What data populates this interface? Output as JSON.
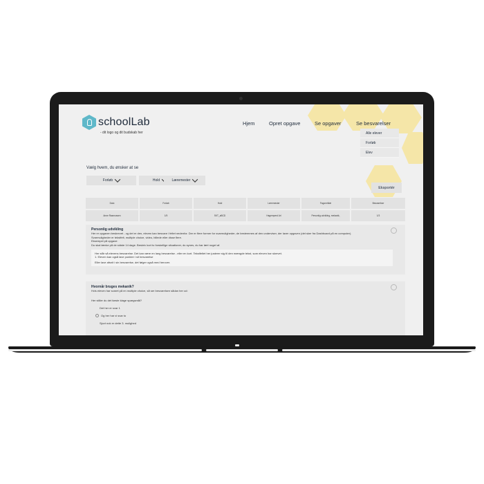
{
  "colors": {
    "accent": "#5fb8c9",
    "hex_yellow": "#f5e6a8",
    "panel": "#e2e2e2"
  },
  "logo": {
    "name": "schoolLab",
    "tagline": "- dit logo og dit budskab her",
    "icon": "lightbulb-icon"
  },
  "nav": {
    "home": "Hjem",
    "create": "Opret opgave",
    "tasks": "Se opgaver",
    "answers": "Se besvarelser",
    "dropdown": [
      "Alle elever",
      "Forløb",
      "Elev"
    ]
  },
  "filters": {
    "heading": "Vælg hvem, du ønsker at se",
    "items": [
      "Forløb",
      "Hold",
      "Læremester"
    ],
    "export": "Eksportér"
  },
  "table": {
    "headers": [
      "Dato",
      "Forløb",
      "Hold",
      "Læremester",
      "Fagområde",
      "Besvarelser"
    ],
    "row": [
      "Anne Rasmussen",
      "1/5",
      "SKT_aBCD",
      "Hagemperd Arl",
      "Personlig udvikling, mekanik,",
      "1/3"
    ]
  },
  "card1": {
    "title": "Personlig udvikling",
    "lines": [
      "Her er opgaven beskrevet - og det er den, eleven kan besvare i feltet nedenfor. Der er flere former for svarmuligheder, de bestemmes af den underviser, der laver opgaven (det sker fra Dashboard på en computer).",
      "Svarmuligheder er tekstfelt, multiple choice, video, billede eller disse flere."
    ],
    "example_label": "Eksempel på opgave:",
    "example_text": "Du skal tænke på de sidste 14 dage. Beskriv kort to forskellige situationer, du synes, du har lært noget af.",
    "answer": [
      "Her står så elevens besvarelse. Det kan være en lang besvarelse - eller en kort. Tekstfeltet her justerer sig til den mængde tekst, som eleven har skrevet.",
      "1. Eleven kan også lave punkter i sit besvarelse",
      "Eller lave afsnit i sin besvarelse, det følger også med herover."
    ]
  },
  "card2": {
    "title": "Hvornår bruges mekanik?",
    "subtitle": "Hvis eleven har svaret på en multiple choice, så ser besvarelsen sådan her ud:",
    "question": "Her stiller du det første klage spørgsmål?",
    "options": [
      "Det her er svar 1",
      "Og her har vi svar to",
      "Sjovt nok er dette 3. mulighed"
    ]
  }
}
